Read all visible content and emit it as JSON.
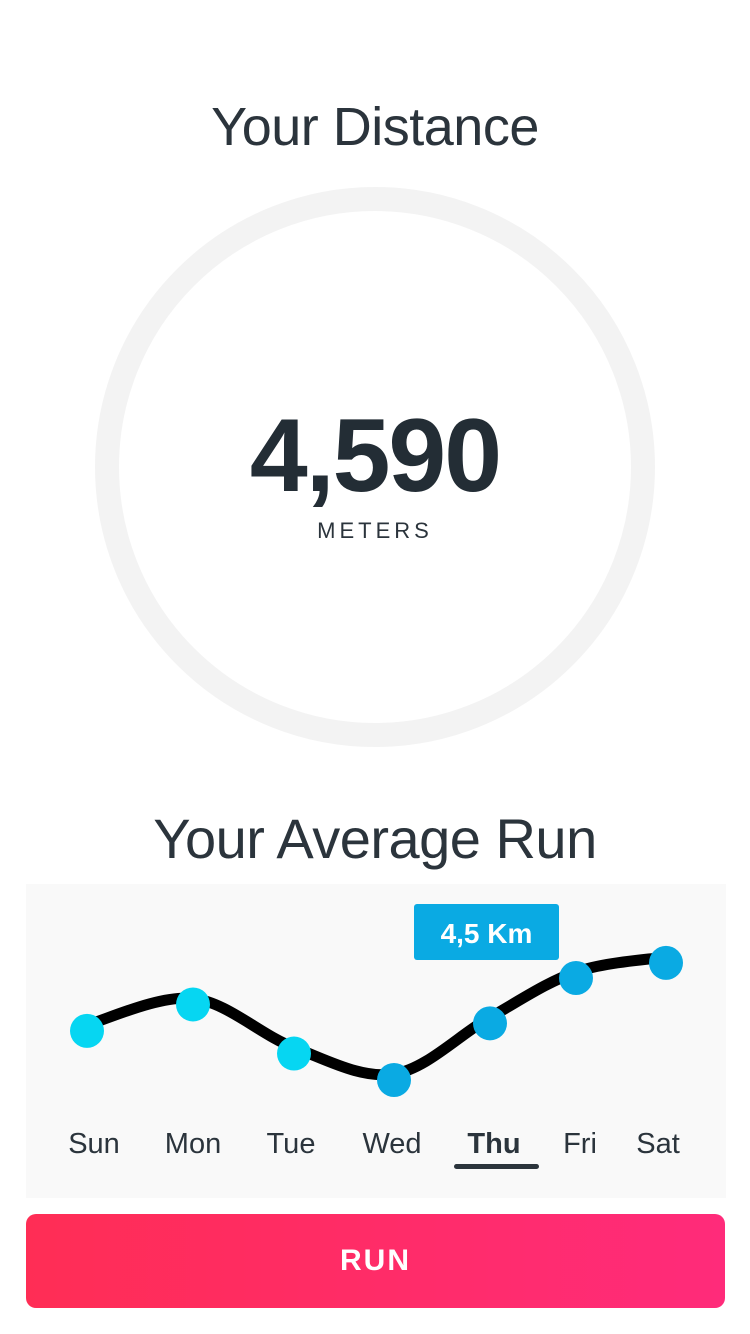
{
  "distance": {
    "title": "Your Distance",
    "value": "4,590",
    "unit": "METERS"
  },
  "average_run": {
    "title": "Your Average Run",
    "tooltip": "4,5 Km",
    "selected_day": "Thu",
    "days": [
      "Sun",
      "Mon",
      "Tue",
      "Wed",
      "Thu",
      "Fri",
      "Sat"
    ]
  },
  "button": {
    "label": "RUN"
  },
  "colors": {
    "accent_start": "#ff2d55",
    "accent_end": "#ff2b7a",
    "point_light": "#06d6f2",
    "point_dark": "#0aaae3",
    "text": "#2b343c",
    "ring": "#f3f3f3"
  },
  "chart_data": {
    "type": "line",
    "categories": [
      "Sun",
      "Mon",
      "Tue",
      "Wed",
      "Thu",
      "Fri",
      "Sat"
    ],
    "series": [
      {
        "values": [
          3.6,
          3.95,
          3.3,
          2.95,
          3.7,
          4.3,
          4.5
        ]
      }
    ],
    "highlighted": {
      "category": "Thu",
      "label": "4,5 Km"
    },
    "ylim": [
      0,
      5
    ],
    "grid": false,
    "legend": "none"
  }
}
